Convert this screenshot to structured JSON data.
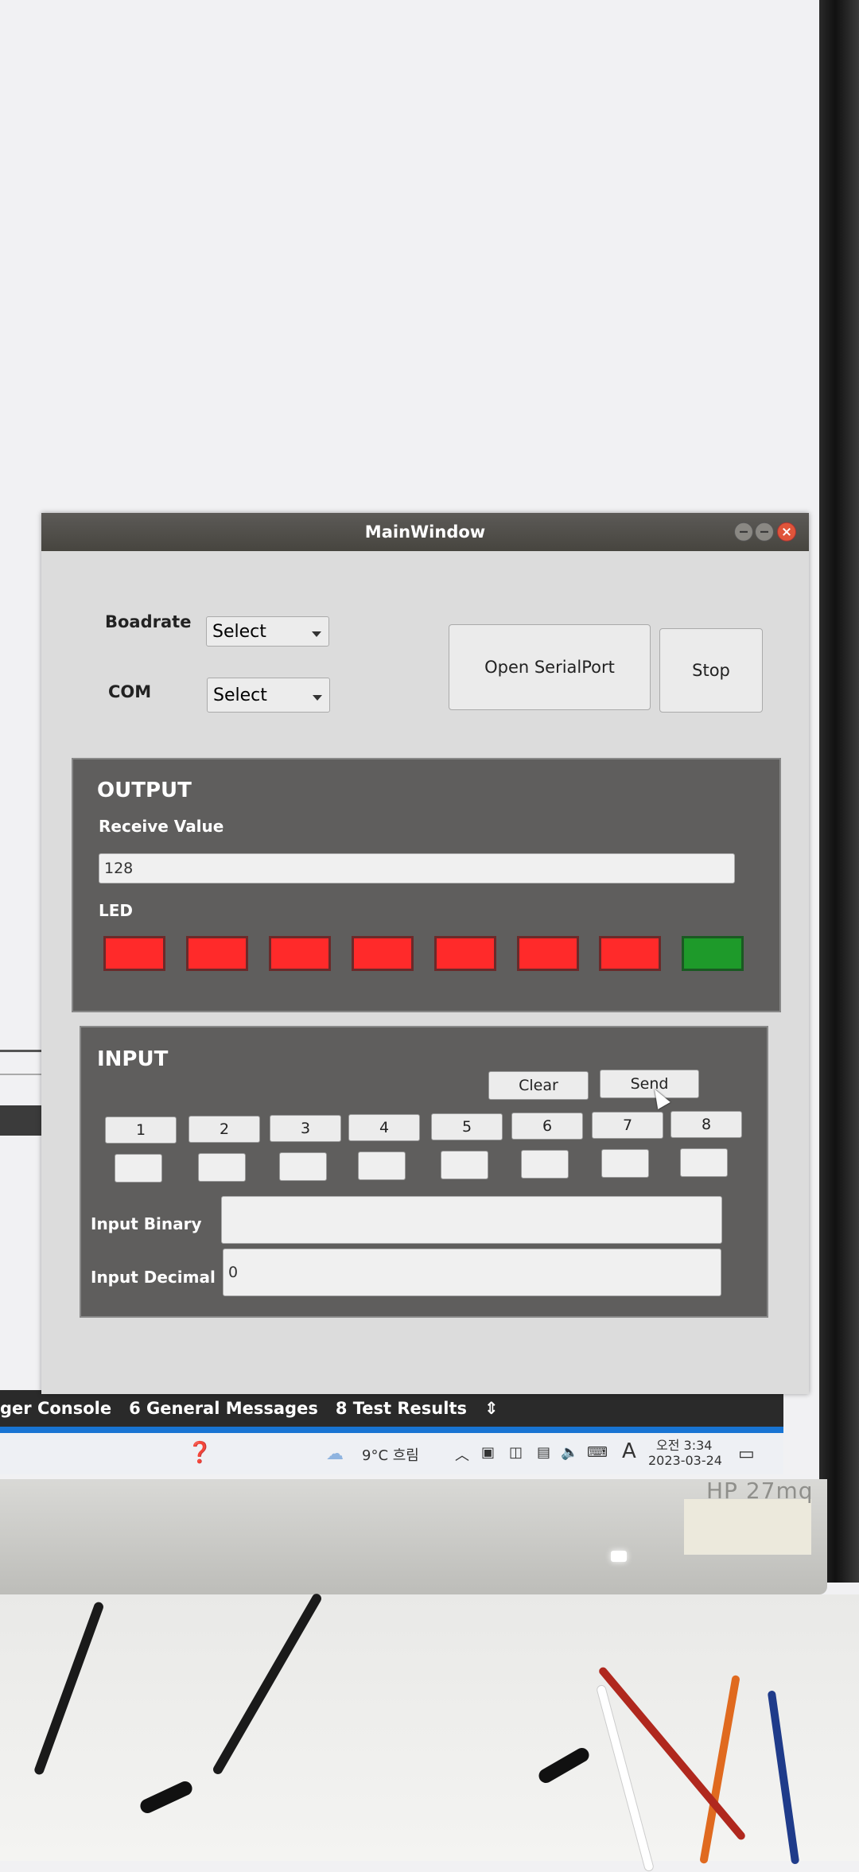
{
  "window": {
    "title": "MainWindow"
  },
  "serial": {
    "baudrate_label": "Boadrate",
    "baudrate_value": "Select",
    "com_label": "COM",
    "com_value": "Select",
    "open_button": "Open SerialPort",
    "stop_button": "Stop"
  },
  "output": {
    "title": "OUTPUT",
    "receive_label": "Receive Value",
    "receive_value": "128",
    "led_label": "LED",
    "leds": [
      {
        "state": "off",
        "color": "#ff2a2a"
      },
      {
        "state": "off",
        "color": "#ff2a2a"
      },
      {
        "state": "off",
        "color": "#ff2a2a"
      },
      {
        "state": "off",
        "color": "#ff2a2a"
      },
      {
        "state": "off",
        "color": "#ff2a2a"
      },
      {
        "state": "off",
        "color": "#ff2a2a"
      },
      {
        "state": "off",
        "color": "#ff2a2a"
      },
      {
        "state": "on",
        "color": "#1e9a2a"
      }
    ]
  },
  "input": {
    "title": "INPUT",
    "clear_button": "Clear",
    "send_button": "Send",
    "bits": [
      "1",
      "2",
      "3",
      "4",
      "5",
      "6",
      "7",
      "8"
    ],
    "binary_label": "Input Binary",
    "binary_value": "",
    "decimal_label": "Input Decimal",
    "decimal_value": "0"
  },
  "ide": {
    "tabs": [
      "ger Console",
      "6 General Messages",
      "8 Test Results"
    ]
  },
  "taskbar": {
    "weather": "9°C 흐림",
    "ime": "A",
    "time": "오전 3:34",
    "date": "2023-03-24"
  },
  "monitor": {
    "brand": "HP 27mq"
  }
}
